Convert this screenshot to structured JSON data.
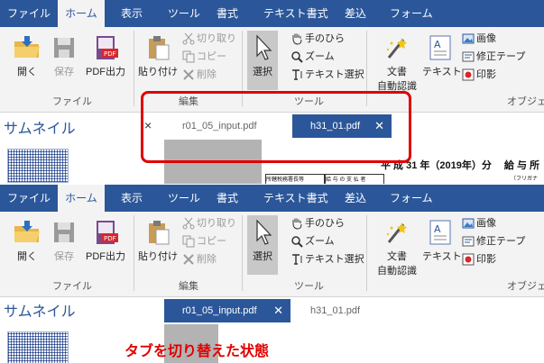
{
  "menu": [
    "ファイル",
    "ホーム",
    "表示",
    "ツール",
    "書式",
    "テキスト書式",
    "差込",
    "フォーム"
  ],
  "ribbon": {
    "file_group": {
      "open": "開く",
      "save": "保存",
      "pdf_out": "PDF出力",
      "label": "ファイル"
    },
    "edit_group": {
      "paste": "貼り付け",
      "cut": "切り取り",
      "copy": "コピー",
      "delete": "削除",
      "label": "編集"
    },
    "tool_group": {
      "select": "選択",
      "hand": "手のひら",
      "zoom": "ズーム",
      "text_select": "テキスト選択",
      "label": "ツール"
    },
    "ocr_group": {
      "ocr_line1": "文書",
      "ocr_line2": "自動認識",
      "text": "テキスト",
      "image": "画像",
      "fix_tape": "修正テープ",
      "stamp": "印影",
      "label": "オブジェ"
    }
  },
  "sidebar": {
    "title": "サムネイル",
    "close": "×"
  },
  "top_view": {
    "tabs": [
      {
        "label": "r01_05_input.pdf",
        "active": false
      },
      {
        "label": "h31_01.pdf",
        "active": true,
        "close": "✕"
      }
    ],
    "doc_text": {
      "header_right": "平 成 31 年（2019年）分　 給 与 所",
      "small_label1": "所轄税務署長等",
      "small_label2": "給 与 の 支 払 者",
      "small_label3": "（フリガナ"
    }
  },
  "bottom_view": {
    "tabs": [
      {
        "label": "r01_05_input.pdf",
        "active": true,
        "close": "✕"
      },
      {
        "label": "h31_01.pdf",
        "active": false
      }
    ],
    "caption": "タブを切り替えた状態"
  },
  "colors": {
    "accent": "#2b579a",
    "highlight": "#e00000"
  }
}
